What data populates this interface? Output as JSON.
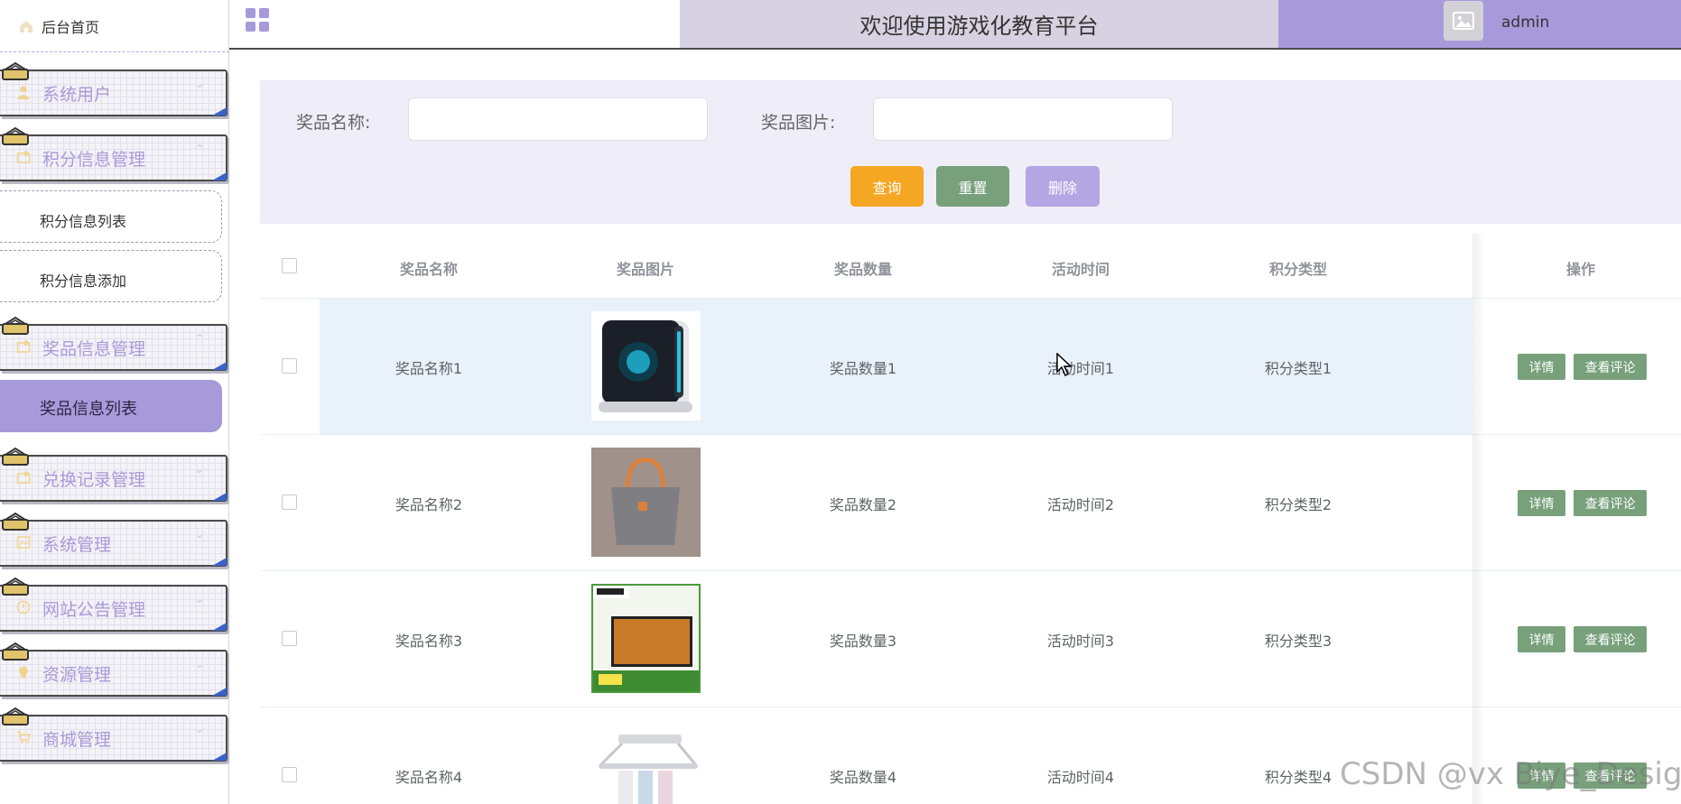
{
  "sidebar": {
    "home_label": "后台首页",
    "menus": [
      {
        "label": "系统用户"
      },
      {
        "label": "积分信息管理"
      },
      {
        "label": "奖品信息管理"
      },
      {
        "label": "兑换记录管理"
      },
      {
        "label": "系统管理"
      },
      {
        "label": "网站公告管理"
      },
      {
        "label": "资源管理"
      },
      {
        "label": "商城管理"
      }
    ],
    "subs": {
      "points_list": "积分信息列表",
      "points_add": "积分信息添加",
      "prize_list": "奖品信息列表"
    }
  },
  "header": {
    "title": "欢迎使用游戏化教育平台",
    "username": "admin"
  },
  "search": {
    "name_label": "奖品名称:",
    "image_label": "奖品图片:",
    "name_value": "",
    "image_value": "",
    "query_button": "查询",
    "reset_button": "重置",
    "delete_button": "删除"
  },
  "table": {
    "columns": [
      "奖品名称",
      "奖品图片",
      "奖品数量",
      "活动时间",
      "积分类型",
      "操作"
    ],
    "rows": [
      {
        "name": "奖品名称1",
        "image": "desktop-pc-image",
        "quantity": "奖品数量1",
        "time": "活动时间1",
        "type": "积分类型1"
      },
      {
        "name": "奖品名称2",
        "image": "tote-bag-image",
        "quantity": "奖品数量2",
        "time": "活动时间2",
        "type": "积分类型2"
      },
      {
        "name": "奖品名称3",
        "image": "sony-tv-image",
        "quantity": "奖品数量3",
        "time": "活动时间3",
        "type": "积分类型3"
      },
      {
        "name": "奖品名称4",
        "image": "drying-rack-image",
        "quantity": "奖品数量4",
        "time": "活动时间4",
        "type": "积分类型4"
      }
    ],
    "detail_button": "详情",
    "comment_button": "查看评论"
  },
  "watermark": "CSDN @vx Biye_Design",
  "colors": {
    "accent": "#a79adb",
    "query": "#f5a623",
    "reset": "#77a07b",
    "delete": "#b3a6e3",
    "header_title_bg": "#d6d2e1",
    "search_bg": "#efedf7"
  }
}
